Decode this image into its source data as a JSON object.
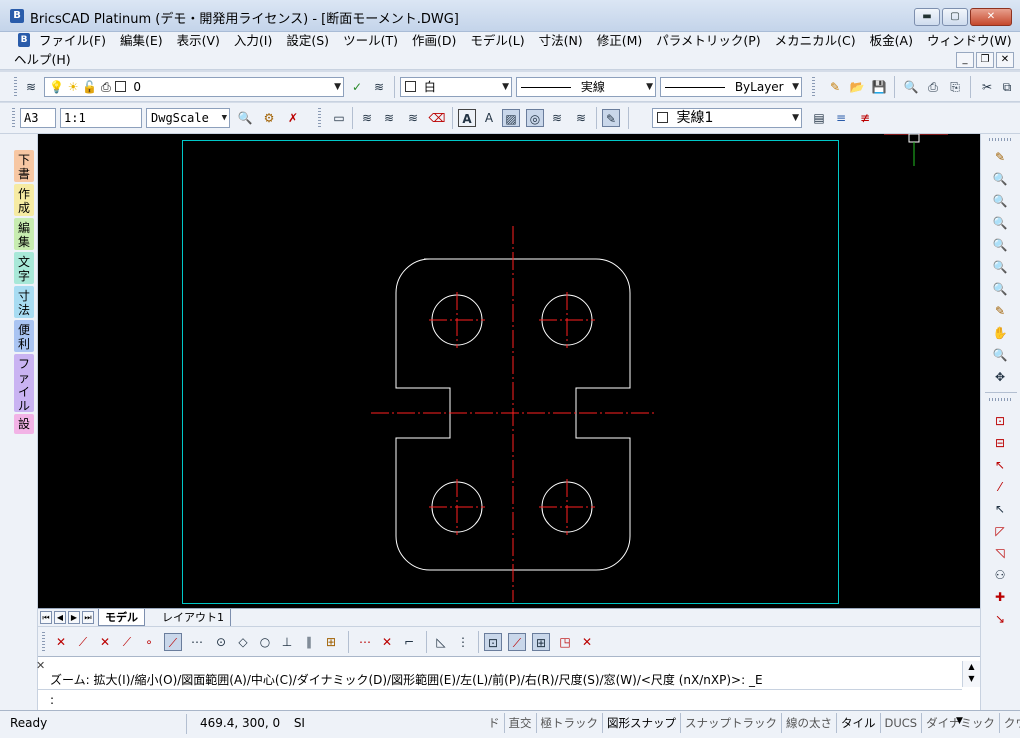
{
  "window": {
    "title": "BricsCAD Platinum (デモ・開発用ライセンス) - [断面モーメント.DWG]",
    "controls": {
      "minimize": "▬",
      "maximize": "▢",
      "close": "✕"
    }
  },
  "menu": {
    "items": [
      {
        "label": "ファイル(F)"
      },
      {
        "label": "編集(E)"
      },
      {
        "label": "表示(V)"
      },
      {
        "label": "入力(I)"
      },
      {
        "label": "設定(S)"
      },
      {
        "label": "ツール(T)"
      },
      {
        "label": "作画(D)"
      },
      {
        "label": "モデル(L)"
      },
      {
        "label": "寸法(N)"
      },
      {
        "label": "修正(M)"
      },
      {
        "label": "パラメトリック(P)"
      },
      {
        "label": "メカニカル(C)"
      },
      {
        "label": "板金(A)"
      },
      {
        "label": "ウィンドウ(W)"
      }
    ],
    "help": "ヘルプ(H)",
    "mdi_controls": {
      "minimize": "_",
      "restore": "❐",
      "close": "✕"
    }
  },
  "toolbar1": {
    "layer_value": "0",
    "color_value": "白",
    "linetype_value": "実線",
    "lineweight_value": "ByLayer"
  },
  "toolbar2": {
    "paper_value": "A3",
    "scale_value": "1:1",
    "dwgscale_value": "DwgScale",
    "textstyle_value": "実線1"
  },
  "left_tabs": [
    {
      "label": "下書",
      "color": "#f7c7a3"
    },
    {
      "label": "作成",
      "color": "#f6eba3"
    },
    {
      "label": "編集",
      "color": "#c7ecb0"
    },
    {
      "label": "文字",
      "color": "#a8e8d8"
    },
    {
      "label": "寸法",
      "color": "#a8dcf2"
    },
    {
      "label": "便利",
      "color": "#a9c4f2"
    },
    {
      "label": "ファイル",
      "color": "#c9b3f2"
    },
    {
      "label": "設",
      "color": "#f2b3e6"
    }
  ],
  "layout_tabs": {
    "model": "モデル",
    "layout1": "レイアウト1"
  },
  "command": {
    "history": "ズーム:  拡大(I)/縮小(O)/図面範囲(A)/中心(C)/ダイナミック(D)/図形範囲(E)/左(L)/前(P)/右(R)/尺度(S)/窓(W)/<尺度 (nX/nXP)>: _E",
    "prompt": ":"
  },
  "status": {
    "ready": "Ready",
    "coords": "469.4, 300, 0",
    "units": "SI",
    "toggles": [
      {
        "label": "ド",
        "on": false
      },
      {
        "label": "直交",
        "on": false
      },
      {
        "label": "極トラック",
        "on": false
      },
      {
        "label": "図形スナップ",
        "on": true
      },
      {
        "label": "スナップトラック",
        "on": false
      },
      {
        "label": "線の太さ",
        "on": false
      },
      {
        "label": "タイル",
        "on": true
      },
      {
        "label": "DUCS",
        "on": false
      },
      {
        "label": "ダイナミック",
        "on": false
      },
      {
        "label": "クウィド",
        "on": false
      }
    ]
  },
  "colors": {
    "frame": "#00c8c8",
    "geometry": "#ffffff",
    "centerline": "#ff2020",
    "background": "#000000"
  }
}
